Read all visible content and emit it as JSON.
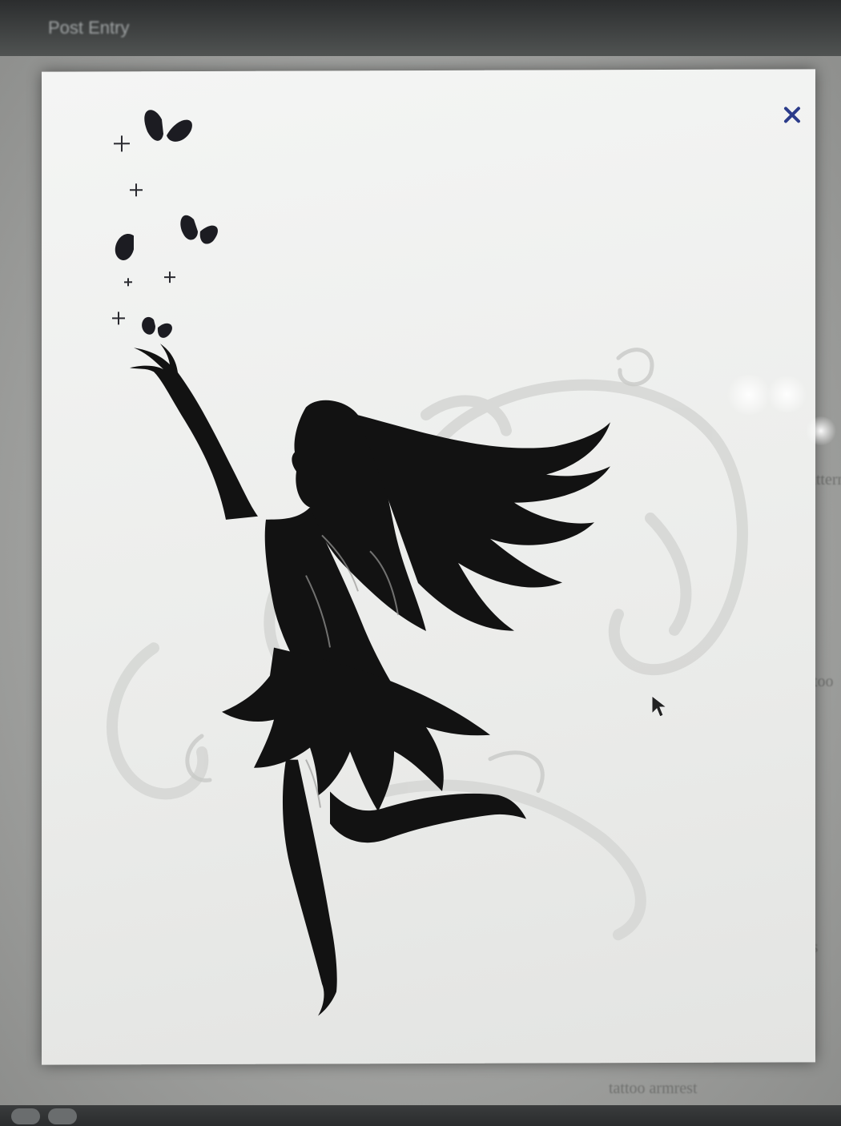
{
  "window": {
    "title": "Post Entry"
  },
  "lightbox": {
    "close_icon": "close-icon",
    "image_subject": "fairy silhouette with butterflies and swirls"
  },
  "background_page": {
    "side_labels": [
      "pattern",
      "tattoo",
      "tattoos",
      "tattoo armrest"
    ]
  },
  "colors": {
    "silhouette": "#121212",
    "panel": "#f1f2f0",
    "swirl": "#cfd0ce",
    "close_icon": "#2b3b8a"
  }
}
